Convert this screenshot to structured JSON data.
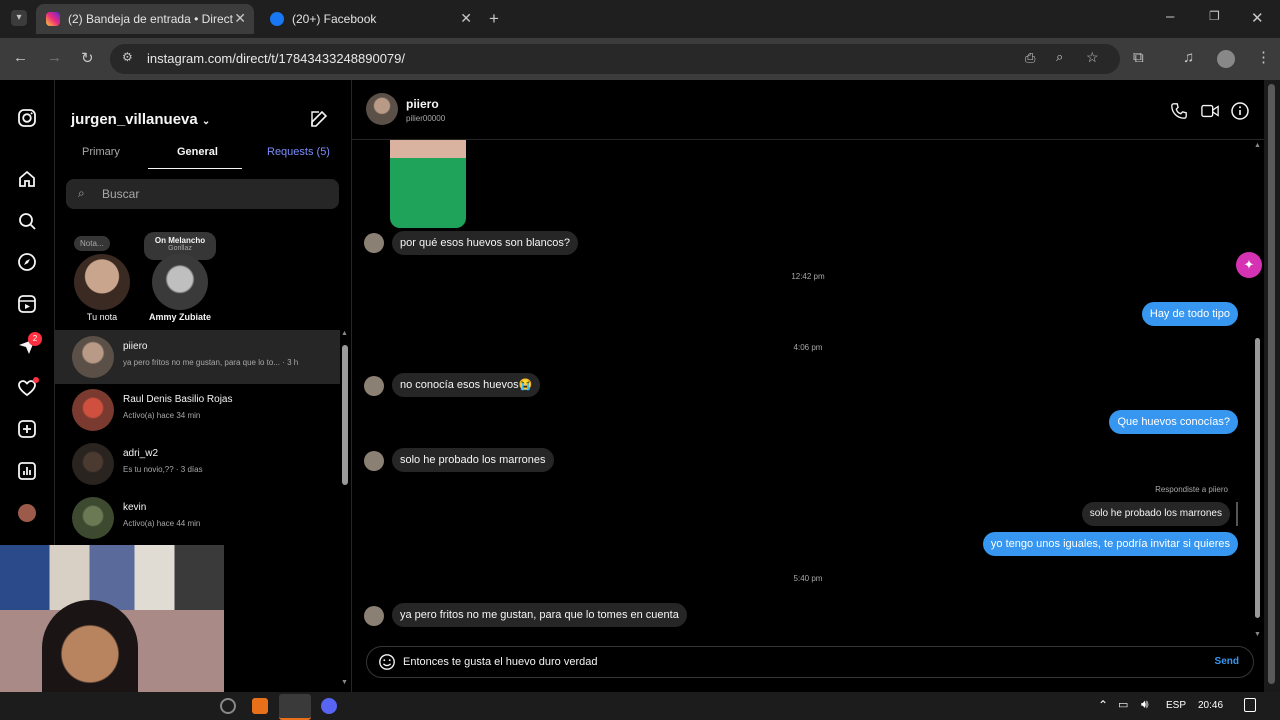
{
  "browser": {
    "tabs": [
      {
        "title": "(2) Bandeja de entrada • Direct"
      },
      {
        "title": "(20+) Facebook"
      }
    ],
    "url": "instagram.com/direct/t/17843433248890079/"
  },
  "sidebar": {
    "username": "jurgen_villanueva",
    "tabs": [
      "Primary",
      "General",
      "Requests (5)"
    ],
    "search_placeholder": "Buscar",
    "messages_badge": "2",
    "notes": [
      {
        "bubble": "Nota...",
        "label": "Tu nota"
      },
      {
        "bubble_title": "On Melancho",
        "bubble_sub": "Gorillaz",
        "label": "Ammy Zubiate"
      }
    ],
    "conversations": [
      {
        "name": "piiero",
        "sub": "ya pero fritos no me gustan, para que lo to... · 3 h"
      },
      {
        "name": "Raul Denis Basilio Rojas",
        "sub": "Activo(a) hace 34 min"
      },
      {
        "name": "adri_w2",
        "sub": "Es tu novio,?? · 3 días"
      },
      {
        "name": "kevin",
        "sub": "Activo(a) hace 44 min"
      }
    ]
  },
  "chat": {
    "name": "piiero",
    "handle": "pilier00000",
    "messages": [
      {
        "dir": "in",
        "text": "por qué esos huevos son blancos?"
      },
      {
        "dir": "ts",
        "text": "12:42 pm"
      },
      {
        "dir": "out",
        "text": "Hay de todo tipo"
      },
      {
        "dir": "ts",
        "text": "4:06 pm"
      },
      {
        "dir": "in",
        "text": "no conocía esos huevos😭"
      },
      {
        "dir": "out",
        "text": "Que huevos conocías?"
      },
      {
        "dir": "in",
        "text": "solo he probado los marrones"
      },
      {
        "dir": "reply_label",
        "text": "Respondiste a piiero"
      },
      {
        "dir": "quoted",
        "text": "solo he probado los marrones"
      },
      {
        "dir": "out",
        "text": "yo tengo unos iguales, te podría invitar si quieres"
      },
      {
        "dir": "ts",
        "text": "5:40 pm"
      },
      {
        "dir": "in",
        "text": "ya pero fritos no me gustan, para que lo tomes en cuenta"
      }
    ],
    "composer_text": "Entonces te gusta el huevo duro verdad",
    "send_label": "Send"
  },
  "taskbar": {
    "lang": "ESP",
    "clock": "20:46"
  },
  "colors": {
    "accent": "#3797f0",
    "requests": "#7b8dff",
    "badge": "#ff3040"
  }
}
